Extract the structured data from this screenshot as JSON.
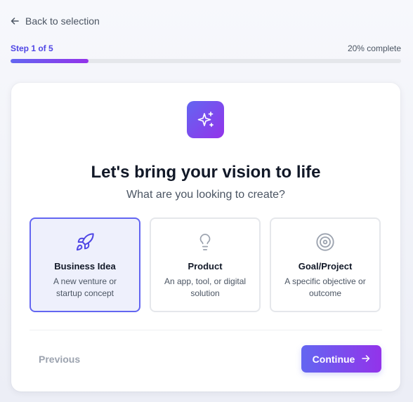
{
  "nav": {
    "back_label": "Back to selection",
    "back_icon": "arrow-left-icon"
  },
  "progress": {
    "step_label": "Step 1 of 5",
    "percent_label": "20% complete",
    "fraction": 0.2
  },
  "card": {
    "hero_icon": "sparkles-icon",
    "headline": "Let's bring your vision to life",
    "subhead": "What are you looking to create?",
    "options": [
      {
        "title": "Business Idea",
        "desc_line1": "A new venture or",
        "desc_line2": "startup concept",
        "icon": "rocket-icon",
        "selected": true
      },
      {
        "title": "Product",
        "desc_line1": "An app, tool, or digital",
        "desc_line2": "solution",
        "icon": "lightbulb-icon",
        "selected": false
      },
      {
        "title": "Goal/Project",
        "desc_line1": "A specific objective or",
        "desc_line2": "outcome",
        "icon": "target-icon",
        "selected": false
      }
    ],
    "previous_label": "Previous",
    "continue_label": "Continue",
    "continue_icon": "arrow-right-icon"
  },
  "colors": {
    "accent": "#6366f1",
    "accent_end": "#9333ea",
    "selected_bg": "#eef0fc",
    "muted_text": "#9ca3af"
  }
}
